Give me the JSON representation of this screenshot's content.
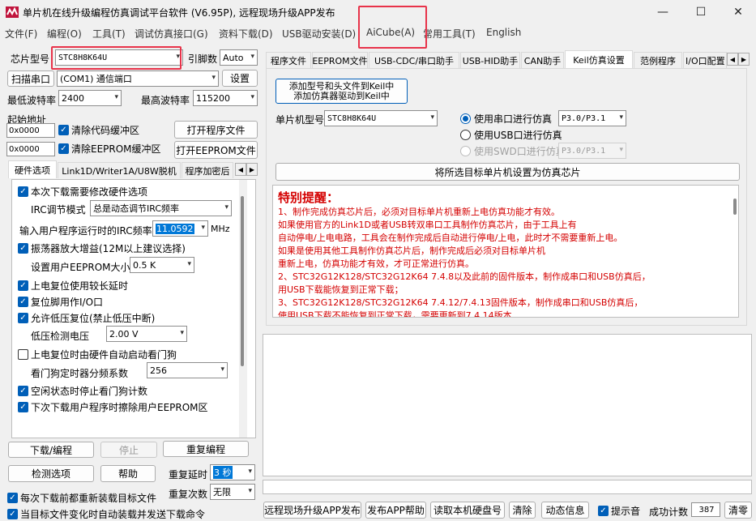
{
  "app": {
    "title": "单片机在线升级编程仿真调试平台软件 (V6.95P), 远程现场升级APP发布"
  },
  "window_controls": {
    "minimize": "—",
    "maximize": "☐",
    "close": "✕"
  },
  "menu": [
    "文件(F)",
    "编程(O)",
    "工具(T)",
    "调试仿真接口(G)",
    "资料下载(D)",
    "USB驱动安装(D)",
    "AiCube(A)",
    "常用工具(T)",
    "English"
  ],
  "left": {
    "chip_label": "芯片型号",
    "chip_value": "STC8H8K64U",
    "pins_label": "引脚数",
    "pins_value": "Auto",
    "scan_port_btn": "扫描串口",
    "port_value": "(COM1) 通信端口",
    "settings_btn": "设置",
    "min_baud_label": "最低波特率",
    "min_baud_value": "2400",
    "max_baud_label": "最高波特率",
    "max_baud_value": "115200",
    "start_addr_label": "起始地址",
    "code_addr": "0x0000",
    "clear_code_label": "清除代码缓冲区",
    "open_prog_btn": "打开程序文件",
    "eeprom_addr": "0x0000",
    "clear_eeprom_label": "清除EEPROM缓冲区",
    "open_eeprom_btn": "打开EEPROM文件",
    "tabs": [
      "硬件选项",
      "Link1D/Writer1A/U8W脱机",
      "程序加密后"
    ],
    "hw": {
      "modify_hw": "本次下载需要修改硬件选项",
      "irc_mode_label": "IRC调节模式",
      "irc_mode_value": "总是动态调节IRC频率",
      "irc_freq_label": "输入用户程序运行时的IRC频率",
      "irc_freq_value": "11.0592",
      "irc_freq_unit": "MHz",
      "osc_gain": "振荡器放大增益(12M以上建议选择)",
      "eeprom_size_label": "设置用户EEPROM大小",
      "eeprom_size_value": "0.5 K",
      "por_delay": "上电复位使用较长延时",
      "reset_io": "复位脚用作I/O口",
      "lvd_reset": "允许低压复位(禁止低压中断)",
      "lvd_voltage_label": "低压检测电压",
      "lvd_voltage_value": "2.00 V",
      "wdt_auto": "上电复位时由硬件自动启动看门狗",
      "wdt_div_label": "看门狗定时器分频系数",
      "wdt_div_value": "256",
      "wdt_idle": "空闲状态时停止看门狗计数",
      "erase_eeprom_next": "下次下载用户程序时擦除用户EEPROM区"
    },
    "bottom": {
      "download_btn": "下载/编程",
      "stop_btn": "停止",
      "reprog_btn": "重复编程",
      "check_btn": "检测选项",
      "help_btn": "帮助",
      "repeat_delay_label": "重复延时",
      "repeat_delay_value": "3 秒",
      "repeat_count_label": "重复次数",
      "repeat_count_value": "无限",
      "reload_each": "每次下载前都重新装载目标文件",
      "auto_send": "当目标文件变化时自动装载并发送下载命令"
    }
  },
  "right": {
    "tabs": [
      "程序文件",
      "EEPROM文件",
      "USB-CDC/串口助手",
      "USB-HID助手",
      "CAN助手",
      "Keil仿真设置",
      "范例程序",
      "I/O口配置"
    ],
    "add_keil_btn_line1": "添加型号和头文件到Keil中",
    "add_keil_btn_line2": "添加仿真器驱动到Keil中",
    "mcu_label": "单片机型号",
    "mcu_value": "STC8H8K64U",
    "radio_serial": "使用串口进行仿真",
    "serial_pins": "P3.0/P3.1",
    "radio_usb": "使用USB口进行仿真",
    "radio_swd": "使用SWD口进行仿真",
    "swd_pins": "P3.0/P3.1",
    "set_emu_btn": "将所选目标单片机设置为仿真芯片",
    "notice_title": "特别提醒：",
    "notice_lines": [
      "1、制作完成仿真芯片后，必须对目标单片机重新上电仿真功能才有效。",
      "   如果使用官方的Link1D或者USB转双串口工具制作仿真芯片，由于工具上有",
      "   自动停电/上电电路，工具会在制作完成后自动进行停电/上电，此时才不需要重新上电。",
      "   如果是使用其他工具制作仿真芯片后，制作完成后必须对目标单片机",
      "   重新上电，仿真功能才有效，才可正常进行仿真。",
      "2、STC32G12K128/STC32G12K64   7.4.8以及此前的固件版本，制作成串口和USB仿真后，",
      "   用USB下载能恢复到正常下载；",
      "3、STC32G12K128/STC32G12K64   7.4.12/7.4.13固件版本，制作成串口和USB仿真后，",
      "   使用USB下载不能恢复到正常下载，需要更新到7.4.14版本"
    ]
  },
  "statusbar": {
    "publish_btn": "远程现场升级APP发布",
    "publish_help_btn": "发布APP帮助",
    "read_disk_btn": "读取本机硬盘号",
    "clear_btn": "清除",
    "dyn_info_btn": "动态信息",
    "beep_label": "提示音",
    "success_label": "成功计数",
    "success_value": "387",
    "reset_btn": "清零"
  },
  "colors": {
    "accent": "#005fb8",
    "highlight": "#e8334a",
    "warning_text": "#d40000"
  }
}
